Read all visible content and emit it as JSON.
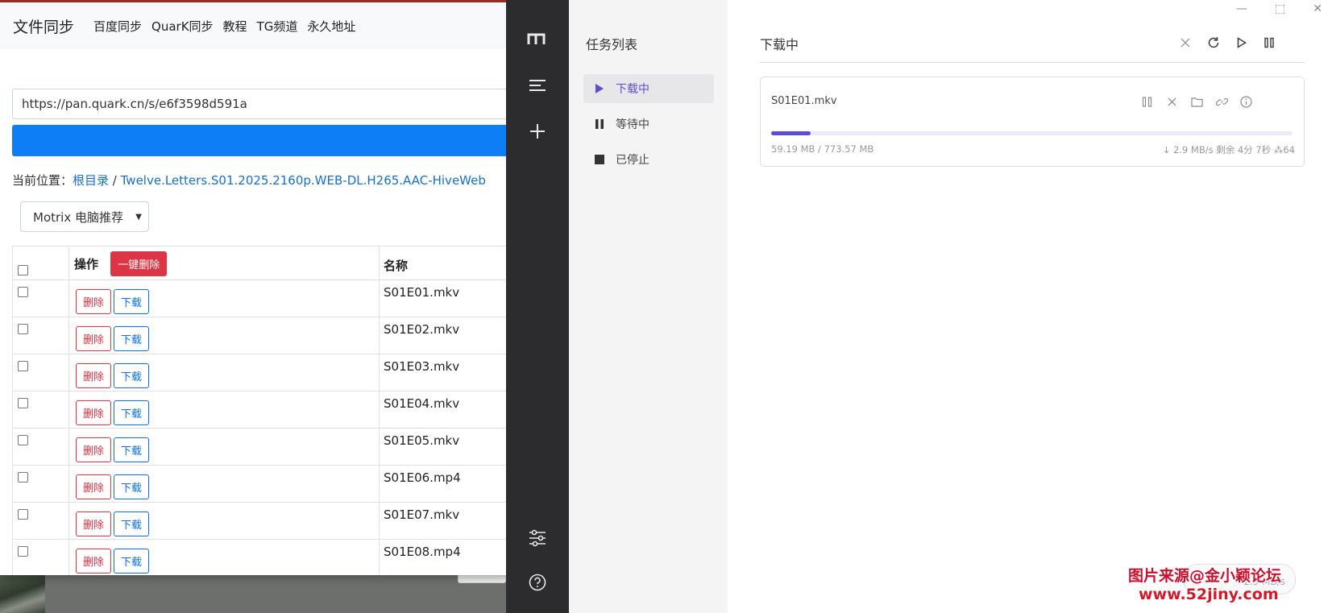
{
  "web": {
    "site_title": "文件同步",
    "nav": [
      "百度同步",
      "QuarK同步",
      "教程",
      "TG频道",
      "永久地址"
    ],
    "url_value": "https://pan.quark.cn/s/e6f3598d591a",
    "breadcrumb_label": "当前位置：",
    "breadcrumb_root": "根目录",
    "breadcrumb_sep": " / ",
    "breadcrumb_folder": "Twelve.Letters.S01.2025.2160p.WEB-DL.H265.AAC-HiveWeb",
    "client_select": "Motrix 电脑推荐",
    "table": {
      "header_ops": "操作",
      "bulk_delete": "一键删除",
      "header_name": "名称",
      "delete_label": "删除",
      "download_label": "下载",
      "rows": [
        {
          "name": "S01E01.mkv"
        },
        {
          "name": "S01E02.mkv"
        },
        {
          "name": "S01E03.mkv"
        },
        {
          "name": "S01E04.mkv"
        },
        {
          "name": "S01E05.mkv"
        },
        {
          "name": "S01E06.mp4"
        },
        {
          "name": "S01E07.mkv"
        },
        {
          "name": "S01E08.mp4"
        }
      ]
    },
    "colors": {
      "primary": "#0d7ef5",
      "danger": "#dc3545",
      "link": "#1a6fc4"
    }
  },
  "motrix": {
    "sidebar_icons": [
      "motrix-logo-icon",
      "menu-icon",
      "plus-icon",
      "settings-sliders-icon",
      "help-icon"
    ],
    "subnav_title": "任务列表",
    "subnav_items": [
      {
        "label": "下载中",
        "icon": "play-icon",
        "active": true
      },
      {
        "label": "等待中",
        "icon": "pause-icon",
        "active": false
      },
      {
        "label": "已停止",
        "icon": "stop-icon",
        "active": false
      }
    ],
    "main_title": "下载中",
    "header_actions": [
      "close-icon",
      "refresh-icon",
      "play-icon",
      "pause-icon"
    ],
    "task": {
      "name": "S01E01.mkv",
      "progress_percent": 7.65,
      "sizes": "59.19 MB / 773.57 MB",
      "speed": "↓ 2.9 MB/s",
      "remaining": "剩余 4分 7秒",
      "connections": "64"
    },
    "accent_color": "#5b4fcf"
  },
  "watermark": {
    "line1": "图片来源@金小颖论坛",
    "line2": "www.52jiny.com"
  },
  "speed_bubble": "2.9 MB/s"
}
